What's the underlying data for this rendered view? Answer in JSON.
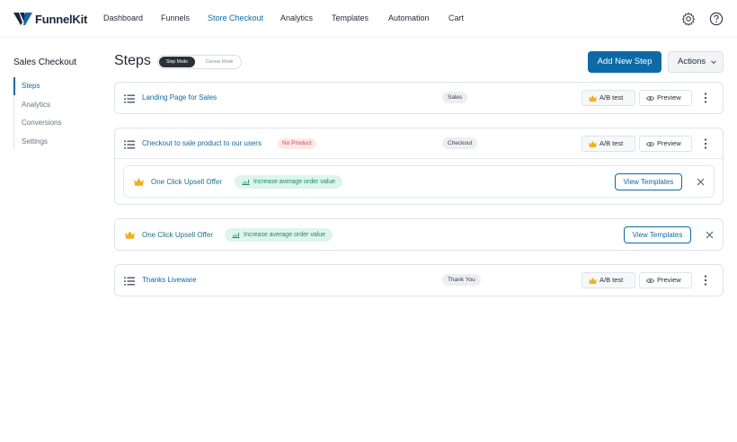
{
  "nav": {
    "logo_text": "FunnelKit",
    "links": [
      "Dashboard",
      "Funnels",
      "Store Checkout",
      "Analytics",
      "Templates",
      "Automation",
      "Cart"
    ],
    "active": "Store Checkout",
    "icons": [
      "gear-icon",
      "help-icon"
    ]
  },
  "sidebar": {
    "title": "Sales Checkout",
    "items": [
      {
        "label": "Steps",
        "active": true
      },
      {
        "label": "Analytics",
        "active": false
      },
      {
        "label": "Conversions",
        "active": false
      },
      {
        "label": "Settings",
        "active": false
      }
    ]
  },
  "header": {
    "title": "Steps",
    "mode_step": "Step Mode",
    "mode_canvas": "Canvas Mode",
    "add_button": "Add New Step",
    "actions_button": "Actions"
  },
  "steps": [
    {
      "name": "Landing Page for Sales",
      "tag": "Sales",
      "ab_label": "A/B test",
      "preview_label": "Preview"
    },
    {
      "name": "Checkout to sale product to our users",
      "badge": "No Product",
      "tag": "Checkout",
      "ab_label": "A/B test",
      "preview_label": "Preview",
      "upsell": {
        "name": "One Click Upsell Offer",
        "pill": "Increase average order value",
        "button": "View Templates"
      }
    },
    {
      "upsell": {
        "name": "One Click Upsell Offer",
        "pill": "Increase average order value",
        "button": "View Templates"
      }
    },
    {
      "name": "Thanks Liveware",
      "tag": "Thank You",
      "ab_label": "A/B test",
      "preview_label": "Preview"
    }
  ],
  "colors": {
    "primary": "#0e6aa6",
    "crown": "#f2b01e",
    "pill_bg": "#def4ec",
    "pill_text": "#1b8a6b",
    "no_product_bg": "#fde8e8",
    "no_product_text": "#d14343"
  }
}
